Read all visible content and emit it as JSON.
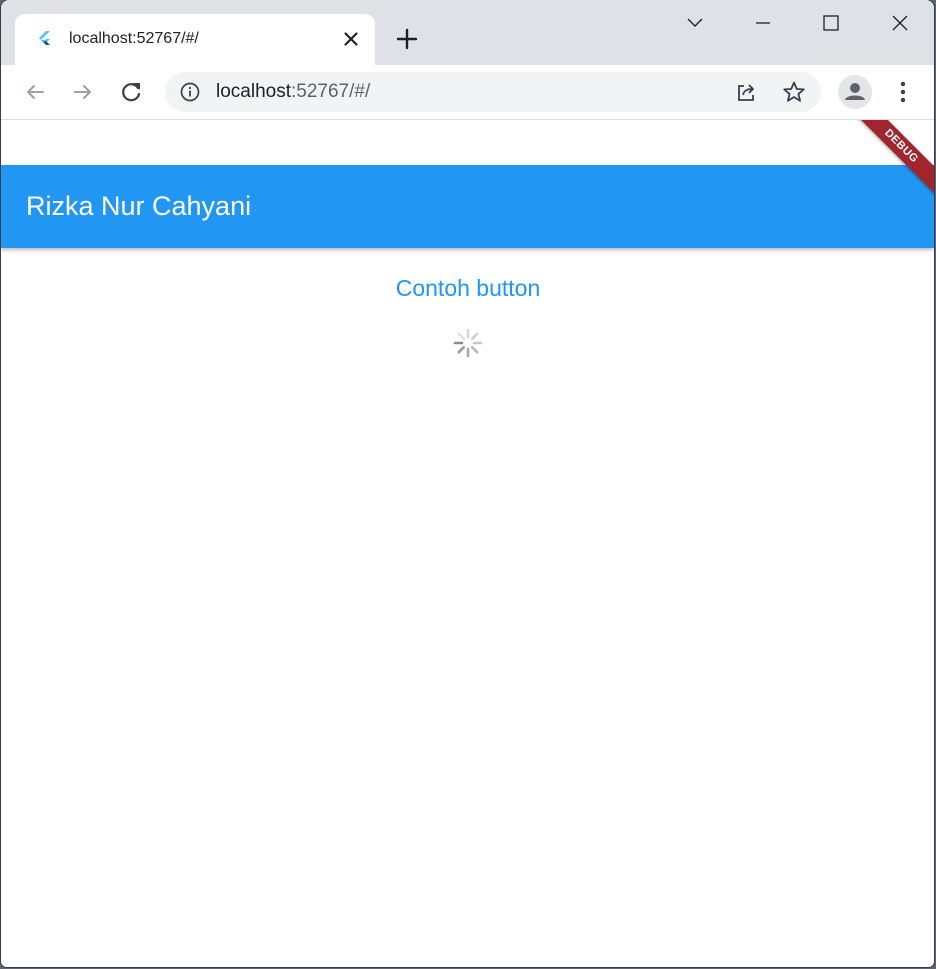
{
  "browser": {
    "tab": {
      "title": "localhost:52767/#/",
      "favicon": "flutter-icon"
    },
    "address_bar": {
      "host": "localhost",
      "path": ":52767/#/",
      "info_icon": "info-icon",
      "share_icon": "share-icon",
      "bookmark_icon": "star-icon"
    },
    "window_controls": [
      "tab-search-icon",
      "minimize-icon",
      "maximize-icon",
      "close-icon"
    ],
    "nav_icons": [
      "back-arrow-icon",
      "forward-arrow-icon",
      "reload-icon"
    ]
  },
  "app": {
    "appbar_title": "Rizka Nur Cahyani",
    "button_label": "Contoh button",
    "debug_banner": "DEBUG",
    "colors": {
      "primary": "#2196f3",
      "debug_banner": "#a0252e"
    }
  }
}
